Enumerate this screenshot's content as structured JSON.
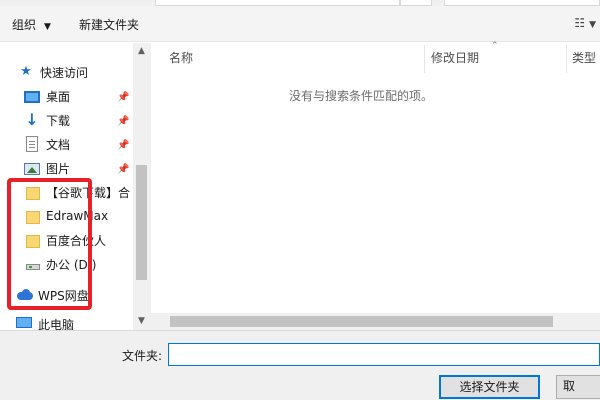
{
  "toolbar": {
    "organize_label": "组织",
    "organize_caret": "▼",
    "new_folder_label": "新建文件夹",
    "view_icon": "view-options-icon",
    "view_caret": "▼"
  },
  "nav": {
    "quick_access": {
      "label": "快速访问",
      "icon": "star-icon"
    },
    "items": [
      {
        "label": "桌面",
        "icon": "desktop-icon",
        "pinned": true
      },
      {
        "label": "下载",
        "icon": "download-arrow-icon",
        "pinned": true
      },
      {
        "label": "文档",
        "icon": "document-icon",
        "pinned": true
      },
      {
        "label": "图片",
        "icon": "pictures-icon",
        "pinned": true
      },
      {
        "label": "【谷歌下载】合",
        "icon": "folder-icon",
        "pinned": false
      },
      {
        "label": "EdrawMax",
        "icon": "folder-icon",
        "pinned": false
      },
      {
        "label": "百度合伙人",
        "icon": "folder-icon",
        "pinned": false
      },
      {
        "label": "办公 (D:)",
        "icon": "drive-icon",
        "pinned": false
      }
    ],
    "wps": {
      "label": "WPS网盘",
      "icon": "cloud-icon"
    },
    "this_pc": {
      "label": "此电脑",
      "icon": "computer-icon"
    },
    "pin_glyph": "📌",
    "scroll_up": "▲",
    "scroll_down": "▼"
  },
  "content": {
    "columns": [
      "名称",
      "修改日期",
      "类型"
    ],
    "sort_caret": "⌃",
    "empty_message": "没有与搜索条件匹配的项。"
  },
  "bottom": {
    "folder_label": "文件夹:",
    "folder_value": "",
    "select_button": "选择文件夹",
    "cancel_button": "取"
  },
  "colors": {
    "accent": "#0078d7",
    "annotation_red": "#e8202a",
    "folder_yellow": "#f8d775"
  }
}
